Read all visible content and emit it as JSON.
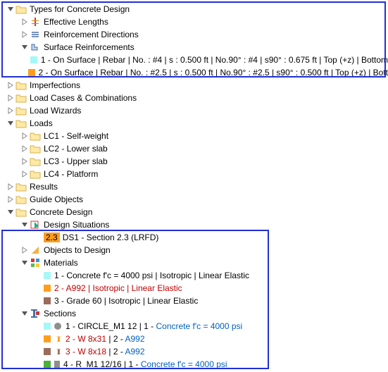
{
  "tree": {
    "types_for_concrete": "Types for Concrete Design",
    "effective_lengths": "Effective Lengths",
    "reinforcement_directions": "Reinforcement Directions",
    "surface_reinforcements": "Surface Reinforcements",
    "sr1": "1 - On Surface | Rebar | No. : #4 | s : 0.500 ft | No.90° : #4 | s90° : 0.675 ft | Top (+z) | Bottom",
    "sr2": "2 - On Surface | Rebar | No. : #2.5 | s : 0.500 ft | No.90° : #2.5 | s90° : 0.500 ft | Top (+z) | Bott",
    "imperfections": "Imperfections",
    "load_cases_comb": "Load Cases & Combinations",
    "load_wizards": "Load Wizards",
    "loads": "Loads",
    "lc1": "LC1 - Self-weight",
    "lc2": "LC2 - Lower slab",
    "lc3": "LC3 - Upper slab",
    "lc4": "LC4 - Platform",
    "results": "Results",
    "guide_objects": "Guide Objects",
    "concrete_design": "Concrete Design",
    "design_situations": "Design Situations",
    "ds1_badge": "2.3",
    "ds1": "DS1 - Section 2.3 (LRFD)",
    "objects_to_design": "Objects to Design",
    "materials": "Materials",
    "mat1": "1 - Concrete f'c = 4000 psi | Isotropic | Linear Elastic",
    "mat2": "2 - A992 | Isotropic | Linear Elastic",
    "mat3": "3 - Grade 60 | Isotropic | Linear Elastic",
    "sections": "Sections",
    "sec1_a": "1 - CIRCLE_M1 12 | 1 - ",
    "sec1_b": "Concrete f'c = 4000 psi",
    "sec2_a": "2 - W 8x31",
    "sec2_b": " | 2 - ",
    "sec2_c": "A992",
    "sec3_a": "3 - W 8x18",
    "sec3_b": " | 2 - ",
    "sec3_c": "A992",
    "sec4_a": "4 - R_M1 12/16 | 1 - ",
    "sec4_b": "Concrete f'c = 4000 psi"
  }
}
